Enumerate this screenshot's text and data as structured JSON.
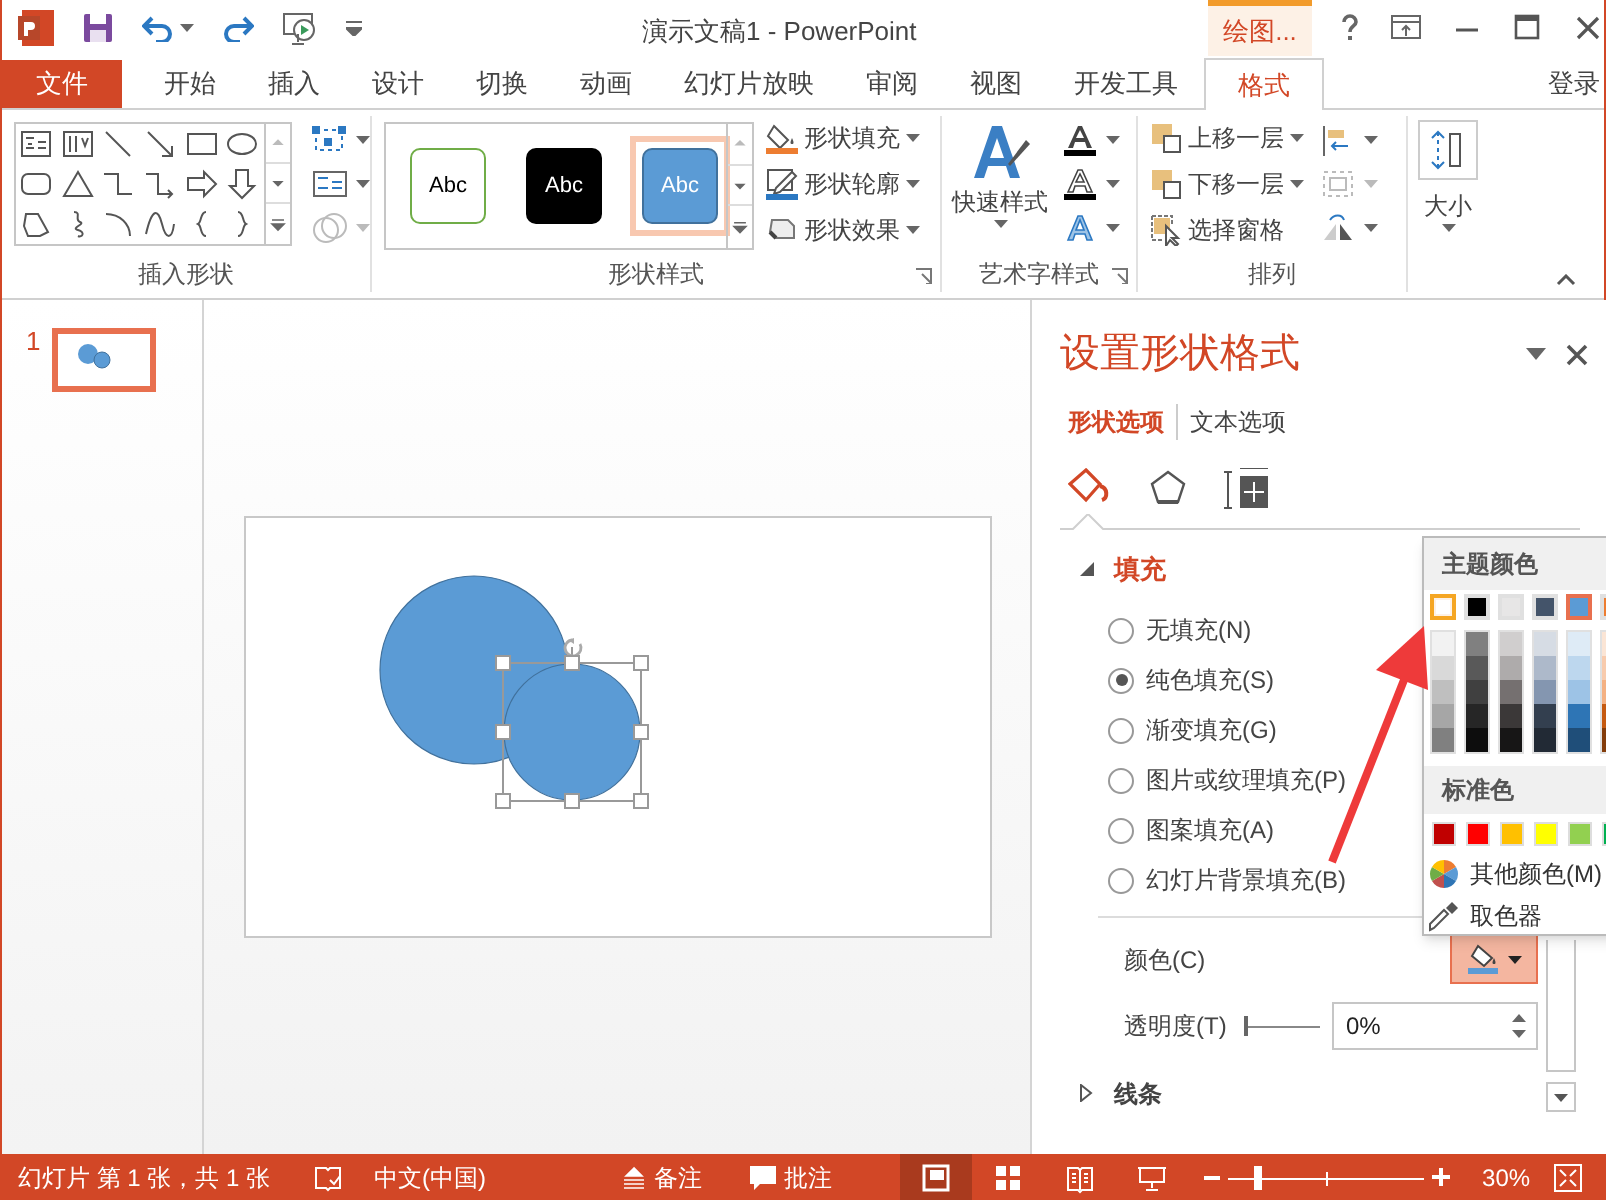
{
  "title_bar": {
    "title": "演示文稿1 - PowerPoint",
    "contextual_tab": "绘图..."
  },
  "tabs": [
    {
      "label": "文件",
      "kind": "file",
      "selected": false
    },
    {
      "label": "开始",
      "kind": "tab",
      "selected": false
    },
    {
      "label": "插入",
      "kind": "tab",
      "selected": false
    },
    {
      "label": "设计",
      "kind": "tab",
      "selected": false
    },
    {
      "label": "切换",
      "kind": "tab",
      "selected": false
    },
    {
      "label": "动画",
      "kind": "tab",
      "selected": false
    },
    {
      "label": "幻灯片放映",
      "kind": "tab",
      "selected": false
    },
    {
      "label": "审阅",
      "kind": "tab",
      "selected": false
    },
    {
      "label": "视图",
      "kind": "tab",
      "selected": false
    },
    {
      "label": "开发工具",
      "kind": "tab",
      "selected": false
    },
    {
      "label": "格式",
      "kind": "tab",
      "selected": true
    }
  ],
  "sign_in": "登录",
  "ribbon": {
    "insert_shapes": {
      "label": "插入形状"
    },
    "shape_styles": {
      "label": "形状样式",
      "presets": [
        {
          "label": "Abc",
          "kind": "outline",
          "selected": false
        },
        {
          "label": "Abc",
          "kind": "dark",
          "selected": false
        },
        {
          "label": "Abc",
          "kind": "accent",
          "selected": true
        }
      ],
      "commands": [
        "形状填充",
        "形状轮廓",
        "形状效果"
      ]
    },
    "wordart_styles": {
      "label": "艺术字样式",
      "quick_styles": "快速样式"
    },
    "arrange": {
      "label": "排列",
      "commands": [
        "上移一层",
        "下移一层",
        "选择窗格"
      ]
    },
    "size": {
      "label": "大小"
    }
  },
  "slide_pane": {
    "slides": [
      {
        "number": "1",
        "selected": true
      }
    ]
  },
  "format_pane": {
    "title": "设置形状格式",
    "tabs": [
      {
        "label": "形状选项",
        "selected": true
      },
      {
        "label": "文本选项",
        "selected": false
      }
    ],
    "icon_tabs": [
      {
        "kind": "fill_line",
        "selected": true
      },
      {
        "kind": "effects",
        "selected": false
      },
      {
        "kind": "size",
        "selected": false
      }
    ],
    "fill": {
      "label": "填充",
      "expanded": true,
      "options": [
        {
          "label": "无填充(N)",
          "selected": false
        },
        {
          "label": "纯色填充(S)",
          "selected": true
        },
        {
          "label": "渐变填充(G)",
          "selected": false
        },
        {
          "label": "图片或纹理填充(P)",
          "selected": false
        },
        {
          "label": "图案填充(A)",
          "selected": false
        },
        {
          "label": "幻灯片背景填充(B)",
          "selected": false
        }
      ],
      "color_label": "颜色(C)",
      "transparency_label": "透明度(T)",
      "transparency": {
        "level": 0,
        "value": "0%"
      }
    },
    "line": {
      "label": "线条",
      "expanded": false
    }
  },
  "color_menu": {
    "theme_header": "主题颜色",
    "theme_colors": [
      {
        "color": "#ffffff",
        "selected": false,
        "hovered": true,
        "shades": [
          {
            "color": "#f2f2f2"
          },
          {
            "color": "#d9d9d9"
          },
          {
            "color": "#bfbfbf"
          },
          {
            "color": "#a6a6a6"
          },
          {
            "color": "#808080"
          }
        ]
      },
      {
        "color": "#000000",
        "selected": false,
        "hovered": false,
        "shades": [
          {
            "color": "#808080"
          },
          {
            "color": "#595959"
          },
          {
            "color": "#404040"
          },
          {
            "color": "#262626"
          },
          {
            "color": "#0d0d0d"
          }
        ]
      },
      {
        "color": "#e7e6e6",
        "selected": false,
        "hovered": false,
        "shades": [
          {
            "color": "#d0cece"
          },
          {
            "color": "#aeabab"
          },
          {
            "color": "#757070"
          },
          {
            "color": "#3b3838"
          },
          {
            "color": "#171616"
          }
        ]
      },
      {
        "color": "#44546a",
        "selected": false,
        "hovered": false,
        "shades": [
          {
            "color": "#d6dce4"
          },
          {
            "color": "#adb9ca"
          },
          {
            "color": "#8496b0"
          },
          {
            "color": "#333f4f"
          },
          {
            "color": "#222a35"
          }
        ]
      },
      {
        "color": "#5b9bd5",
        "selected": true,
        "hovered": false,
        "shades": [
          {
            "color": "#deebf6"
          },
          {
            "color": "#bdd7ee"
          },
          {
            "color": "#9dc3e6"
          },
          {
            "color": "#2e75b5"
          },
          {
            "color": "#1f4e79"
          }
        ]
      },
      {
        "color": "#ed7d31",
        "selected": false,
        "hovered": false,
        "shades": [
          {
            "color": "#fbe5d5"
          },
          {
            "color": "#f8cbad"
          },
          {
            "color": "#f4b183"
          },
          {
            "color": "#c55a11"
          },
          {
            "color": "#833c0b"
          }
        ]
      }
    ],
    "standard_header": "标准色",
    "standard_colors": [
      {
        "color": "#c00000"
      },
      {
        "color": "#ff0000"
      },
      {
        "color": "#ffc000"
      },
      {
        "color": "#ffff00"
      },
      {
        "color": "#92d050"
      },
      {
        "color": "#00b050"
      }
    ],
    "more_colors": "其他颜色(M)",
    "eyedropper": "取色器"
  },
  "status_bar": {
    "slide_info": "幻灯片 第 1 张，共 1 张",
    "language": "中文(中国)",
    "notes": "备注",
    "comments": "批注",
    "views": [
      {
        "kind": "normal",
        "selected": true
      },
      {
        "kind": "sorter",
        "selected": false
      },
      {
        "kind": "reading",
        "selected": false
      },
      {
        "kind": "slideshow",
        "selected": false
      }
    ],
    "zoom": {
      "level": 0.14,
      "value": "30%"
    }
  }
}
